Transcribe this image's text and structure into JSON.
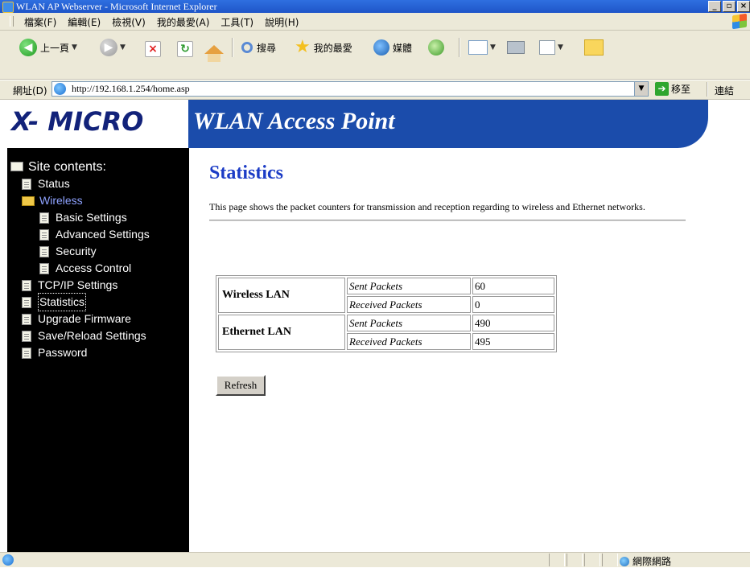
{
  "window": {
    "title": "WLAN AP Webserver - Microsoft Internet Explorer"
  },
  "menu": {
    "items": [
      "檔案(F)",
      "編輯(E)",
      "檢視(V)",
      "我的最愛(A)",
      "工具(T)",
      "說明(H)"
    ]
  },
  "toolbar": {
    "back_label": "上一頁",
    "search_label": "搜尋",
    "favorites_label": "我的最愛",
    "media_label": "媒體"
  },
  "address": {
    "label": "網址(D)",
    "url": "http://192.168.1.254/home.asp",
    "go_label": "移至",
    "links_label": "連結"
  },
  "banner": {
    "logo": "X- MICRO",
    "title": "WLAN Access Point"
  },
  "sidebar": {
    "root": "Site contents:",
    "items": [
      {
        "label": "Status"
      },
      {
        "label": "Wireless"
      },
      {
        "label": "Basic Settings"
      },
      {
        "label": "Advanced Settings"
      },
      {
        "label": "Security"
      },
      {
        "label": "Access Control"
      },
      {
        "label": "TCP/IP Settings"
      },
      {
        "label": "Statistics"
      },
      {
        "label": "Upgrade Firmware"
      },
      {
        "label": "Save/Reload Settings"
      },
      {
        "label": "Password"
      }
    ]
  },
  "content": {
    "heading": "Statistics",
    "description": "This page shows the packet counters for transmission and reception regarding to wireless and Ethernet networks.",
    "table": {
      "groups": [
        {
          "name": "Wireless LAN",
          "rows": [
            {
              "label": "Sent Packets",
              "value": "60"
            },
            {
              "label": "Received Packets",
              "value": "0"
            }
          ]
        },
        {
          "name": "Ethernet LAN",
          "rows": [
            {
              "label": "Sent Packets",
              "value": "490"
            },
            {
              "label": "Received Packets",
              "value": "495"
            }
          ]
        }
      ]
    },
    "refresh_label": "Refresh"
  },
  "status": {
    "zone": "網際網路"
  }
}
